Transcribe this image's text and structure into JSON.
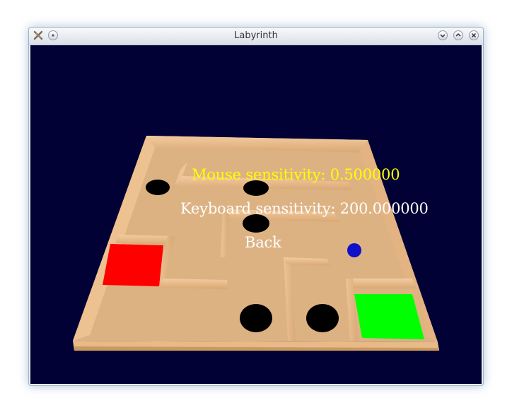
{
  "window": {
    "title": "Labyrinth"
  },
  "menu": {
    "mouse_sensitivity": "Mouse sensitivity: 0.500000",
    "keyboard_sensitivity": "Keyboard sensitivity: 200.000000",
    "back": "Back",
    "selected_color": "#ffff00",
    "normal_color": "#ffffff"
  },
  "scene": {
    "background_color": "#010135",
    "board_color": "#ddb283",
    "wall_color": "#eec497",
    "hole_color": "#000000",
    "start_pad_color": "#ff0000",
    "goal_pad_color": "#00ff00",
    "ball_color": "#1010c8"
  }
}
